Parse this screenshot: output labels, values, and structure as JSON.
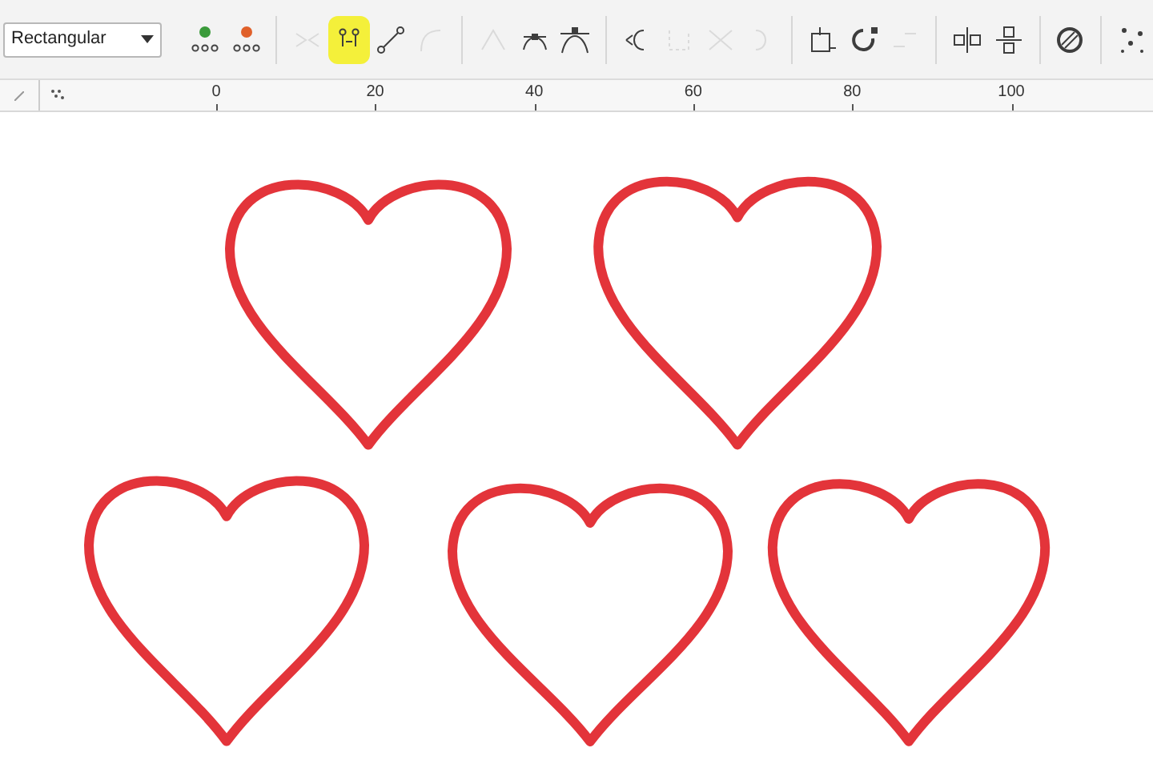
{
  "toolbar": {
    "selection_mode": {
      "value": "Rectangular"
    },
    "groups": [
      [
        {
          "kind": "add",
          "disabled": false,
          "highlighted": false
        },
        {
          "kind": "delete",
          "disabled": false,
          "highlighted": false
        }
      ],
      [
        {
          "kind": "join",
          "disabled": true,
          "highlighted": false
        },
        {
          "kind": "break",
          "disabled": false,
          "highlighted": true
        },
        {
          "kind": "line",
          "disabled": false,
          "highlighted": false
        },
        {
          "kind": "curve",
          "disabled": true,
          "highlighted": false
        }
      ],
      [
        {
          "kind": "cusp",
          "disabled": true,
          "highlighted": false
        },
        {
          "kind": "smooth",
          "disabled": false,
          "highlighted": false
        },
        {
          "kind": "symmetric",
          "disabled": false,
          "highlighted": false
        }
      ],
      [
        {
          "kind": "reverse",
          "disabled": false,
          "highlighted": false
        },
        {
          "kind": "extend",
          "disabled": true,
          "highlighted": false
        },
        {
          "kind": "extract",
          "disabled": true,
          "highlighted": false
        },
        {
          "kind": "close",
          "disabled": true,
          "highlighted": false
        }
      ],
      [
        {
          "kind": "stretch",
          "disabled": false,
          "highlighted": false
        },
        {
          "kind": "rotate",
          "disabled": false,
          "highlighted": false
        },
        {
          "kind": "align",
          "disabled": true,
          "highlighted": false
        }
      ],
      [
        {
          "kind": "mirror_h",
          "disabled": false,
          "highlighted": false
        },
        {
          "kind": "mirror_v",
          "disabled": false,
          "highlighted": false
        }
      ],
      [
        {
          "kind": "elastic",
          "disabled": false,
          "highlighted": false
        }
      ],
      [
        {
          "kind": "select_all",
          "disabled": false,
          "highlighted": false
        }
      ]
    ]
  },
  "ruler": {
    "labels": [
      "0",
      "20",
      "40",
      "60",
      "80",
      "100"
    ]
  }
}
